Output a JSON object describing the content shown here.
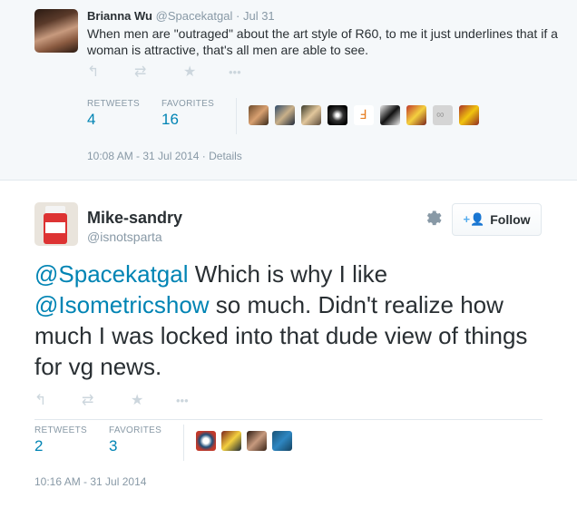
{
  "parent_tweet": {
    "author_name": "Brianna Wu",
    "handle": "@Spacekatgal",
    "date": "Jul 31",
    "text": "When men are \"outraged\" about the art style of R60, to me it just underlines that if a woman is attractive, that's all men are able to see.",
    "actions": {
      "reply_icon": "↰",
      "retweet_icon": "⇄",
      "favorite_icon": "★",
      "more_icon": "•••"
    },
    "stats": {
      "retweets_label": "RETWEETS",
      "retweets_count": "4",
      "favorites_label": "FAVORITES",
      "favorites_count": "16"
    },
    "timestamp": "10:08 AM - 31 Jul 2014",
    "details_link": "Details"
  },
  "main_tweet": {
    "author_name": "Mike-sandry",
    "handle": "@isnotsparta",
    "follow_label": "Follow",
    "follow_icon": "+👤",
    "text_mention_1": "@Spacekatgal",
    "text_part_1": " Which is why I like ",
    "text_mention_2": "@Isometricshow",
    "text_part_2": " so much. Didn't realize how much I was locked into that dude view of things for vg news.",
    "actions": {
      "reply_icon": "↰",
      "retweet_icon": "⇄",
      "favorite_icon": "★",
      "more_icon": "•••"
    },
    "stats": {
      "retweets_label": "RETWEETS",
      "retweets_count": "2",
      "favorites_label": "FAVORITES",
      "favorites_count": "3"
    },
    "timestamp": "10:16 AM - 31 Jul 2014"
  },
  "colors": {
    "link": "#0084b4",
    "muted": "#8899a6",
    "text": "#292f33",
    "icon": "#ccd6dd",
    "parent_bg": "#f5f8fa"
  }
}
